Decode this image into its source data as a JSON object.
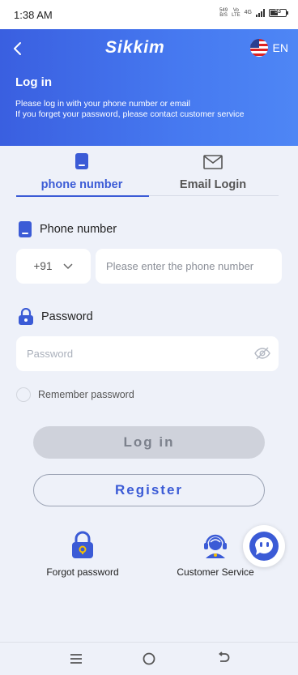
{
  "status_bar": {
    "time": "1:38 AM",
    "speed_value": "549",
    "speed_unit": "B/S",
    "volte_top": "Vo",
    "volte_bottom": "LTE",
    "network": "4G",
    "battery": "33"
  },
  "header": {
    "logo_text": "Sikkim",
    "lang_label": "EN",
    "title": "Log in",
    "description_line1": "Please log in with your phone number or email",
    "description_line2": "If you forget your password, please contact customer service",
    "gradient_start": "#3a5fe0",
    "gradient_end": "#4e86f5"
  },
  "tabs": [
    {
      "label": "phone number",
      "icon": "phone-icon",
      "active": true
    },
    {
      "label": "Email Login",
      "icon": "envelope-icon",
      "active": false
    }
  ],
  "form": {
    "phone_label": "Phone number",
    "country_code": "+91",
    "phone_placeholder": "Please enter the phone number",
    "password_label": "Password",
    "password_placeholder": "Password",
    "remember_label": "Remember password"
  },
  "buttons": {
    "login": "Log in",
    "register": "Register"
  },
  "actions": {
    "forgot": "Forgot password",
    "service": "Customer Service"
  },
  "colors": {
    "accent": "#3b5bd6",
    "background": "#eef1f9"
  }
}
